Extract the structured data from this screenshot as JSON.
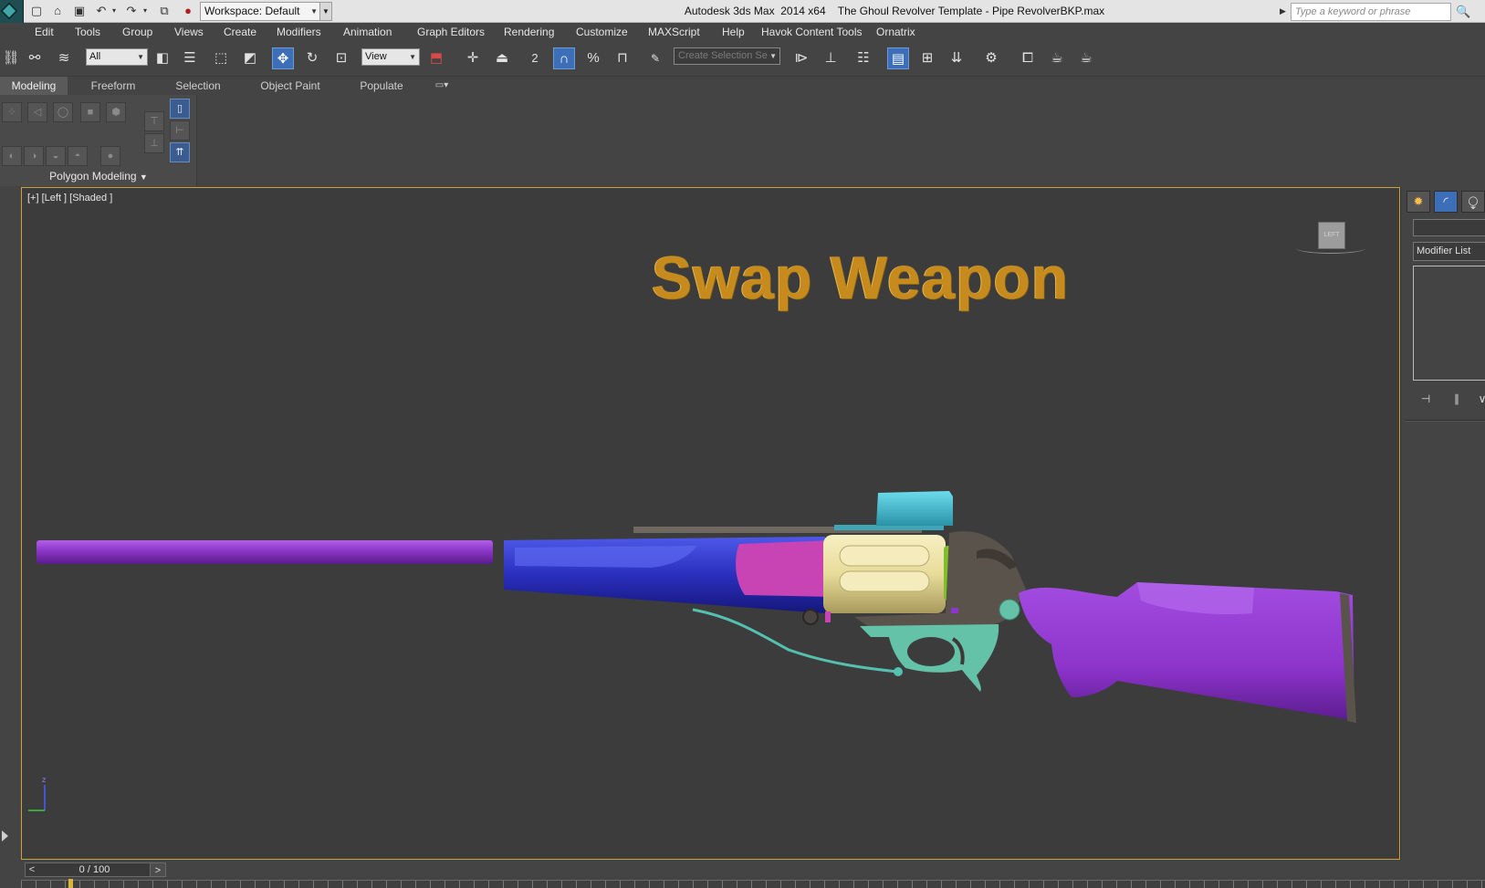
{
  "titlebar": {
    "workspace": "Workspace: Default",
    "app_name": "Autodesk 3ds Max  2014 x64",
    "file_title": "The Ghoul Revolver Template - Pipe RevolverBKP.max",
    "search_placeholder": "Type a keyword or phrase"
  },
  "menu": [
    "Edit",
    "Tools",
    "Group",
    "Views",
    "Create",
    "Modifiers",
    "Animation",
    "Graph Editors",
    "Rendering",
    "Customize",
    "MAXScript",
    "Help",
    "Havok Content Tools",
    "Ornatrix"
  ],
  "toolbar": {
    "selection_filter": "All",
    "ref_coord": "View",
    "create_selection_set": "Create Selection Se",
    "snap_label": "2",
    "percent_label": "%"
  },
  "ribbon": {
    "tabs": [
      "Modeling",
      "Freeform",
      "Selection",
      "Object Paint",
      "Populate"
    ],
    "active_tab": "Modeling",
    "panel_label": "Polygon Modeling"
  },
  "viewport": {
    "label": "[+] [Left ] [Shaded ]",
    "overlay_text": "Swap Weapon",
    "overlay_color": "#c68b1c",
    "viewcube_label": "LEFT",
    "frame_color": "#c9a33a",
    "gizmo_axis": "z"
  },
  "command_panel": {
    "modifier_list": "Modifier List",
    "tab_icons": [
      "sun-icon",
      "curve-icon",
      "hierarchy-icon"
    ]
  },
  "timeline": {
    "frame_display": "0 / 100",
    "prev": "<",
    "next": ">"
  },
  "colors": {
    "barrel": "#8a36c6",
    "handguard": "#2a2fbd",
    "magenta_insert": "#c844b4",
    "cylinder": "#e8dc9a",
    "scope": "#3cb7cc",
    "trigger_parts": "#64c2a8",
    "stock": "#8e35cc",
    "frame_metal": "#5a534c",
    "accent_green": "#7fc02a"
  }
}
